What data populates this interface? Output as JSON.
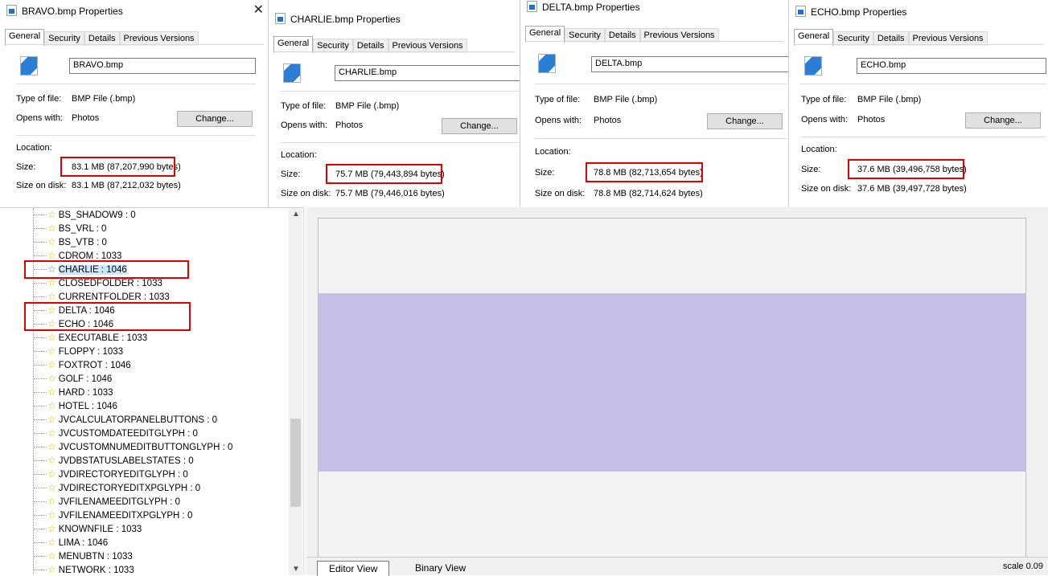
{
  "tab_labels": [
    "General",
    "Security",
    "Details",
    "Previous Versions"
  ],
  "field_labels": {
    "type": "Type of file:",
    "opens": "Opens with:",
    "location": "Location:",
    "size": "Size:",
    "size_on_disk": "Size on disk:",
    "change_button": "Change..."
  },
  "dialogs": [
    {
      "title": "BRAVO.bmp Properties",
      "filename": "BRAVO.bmp",
      "type_value": "BMP File (.bmp)",
      "opens_value": "Photos",
      "size_value": "83.1 MB (87,207,990 bytes)",
      "size_on_disk_value": "83.1 MB (87,212,032 bytes)"
    },
    {
      "title": "CHARLIE.bmp Properties",
      "filename": "CHARLIE.bmp",
      "type_value": "BMP File (.bmp)",
      "opens_value": "Photos",
      "size_value": "75.7 MB (79,443,894 bytes)",
      "size_on_disk_value": "75.7 MB (79,446,016 bytes)"
    },
    {
      "title": "DELTA.bmp Properties",
      "filename": "DELTA.bmp",
      "type_value": "BMP File (.bmp)",
      "opens_value": "Photos",
      "size_value": "78.8 MB (82,713,654 bytes)",
      "size_on_disk_value": "78.8 MB (82,714,624 bytes)"
    },
    {
      "title": "ECHO.bmp Properties",
      "filename": "ECHO.bmp",
      "type_value": "BMP File (.bmp)",
      "opens_value": "Photos",
      "size_value": "37.6 MB (39,496,758 bytes)",
      "size_on_disk_value": "37.6 MB (39,497,728 bytes)"
    }
  ],
  "tree": {
    "selected": "CHARLIE : 1046",
    "items": [
      "BS_SHADOW9 : 0",
      "BS_VRL : 0",
      "BS_VTB : 0",
      "CDROM : 1033",
      "CHARLIE : 1046",
      "CLOSEDFOLDER : 1033",
      "CURRENTFOLDER : 1033",
      "DELTA : 1046",
      "ECHO : 1046",
      "EXECUTABLE : 1033",
      "FLOPPY : 1033",
      "FOXTROT : 1046",
      "GOLF : 1046",
      "HARD : 1033",
      "HOTEL : 1046",
      "JVCALCULATORPANELBUTTONS : 0",
      "JVCUSTOMDATEEDITGLYPH : 0",
      "JVCUSTOMNUMEDITBUTTONGLYPH : 0",
      "JVDBSTATUSLABELSTATES : 0",
      "JVDIRECTORYEDITGLYPH : 0",
      "JVDIRECTORYEDITXPGLYPH : 0",
      "JVFILENAMEEDITGLYPH : 0",
      "JVFILENAMEEDITXPGLYPH : 0",
      "KNOWNFILE : 1033",
      "LIMA : 1046",
      "MENUBTN : 1033",
      "NETWORK : 1033"
    ]
  },
  "editor": {
    "tabs": [
      "Editor View",
      "Binary View"
    ],
    "active_tab": "Editor View",
    "scale": "scale 0.09",
    "band_color": "#c6bee4"
  },
  "colors": {
    "highlight_box": "#e00000",
    "tree_star": "#e8b400",
    "selection": "#cce8ff"
  }
}
